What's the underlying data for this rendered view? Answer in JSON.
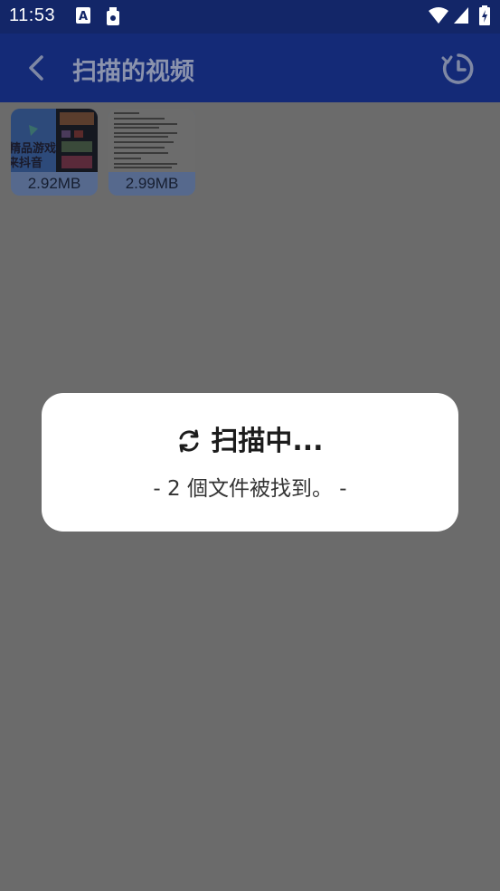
{
  "status_bar": {
    "time": "11:53"
  },
  "app_bar": {
    "title": "扫描的视频"
  },
  "files": [
    {
      "size": "2.92MB",
      "thumb_text_line1": "精品游戏",
      "thumb_text_line2": "来抖音"
    },
    {
      "size": "2.99MB"
    }
  ],
  "dialog": {
    "title": "扫描中...",
    "subtitle": "- 2 個文件被找到。 -"
  },
  "colors": {
    "status_bar": "#132668",
    "app_bar": "#142a77",
    "overlay": "#6b6b6b",
    "dialog_bg": "#ffffff"
  }
}
